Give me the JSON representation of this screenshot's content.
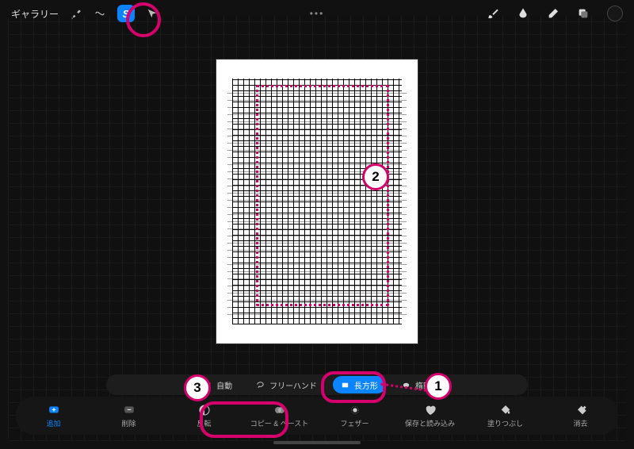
{
  "accent": "#0a84ff",
  "annotation_color": "#d6006c",
  "topbar": {
    "gallery": "ギャラリー",
    "menu_dots": "•••"
  },
  "annotations": {
    "n1": "1",
    "n2": "2",
    "n3": "3"
  },
  "mode_bar": {
    "auto": "自動",
    "freehand": "フリーハンド",
    "rectangle": "長方形",
    "ellipse": "楕円"
  },
  "action_bar": {
    "add": "追加",
    "remove": "削除",
    "invert": "反転",
    "copy_paste": "コピー & ペースト",
    "feather": "フェザー",
    "save_load": "保存と読み込み",
    "fill": "塗りつぶし",
    "clear": "消去"
  }
}
